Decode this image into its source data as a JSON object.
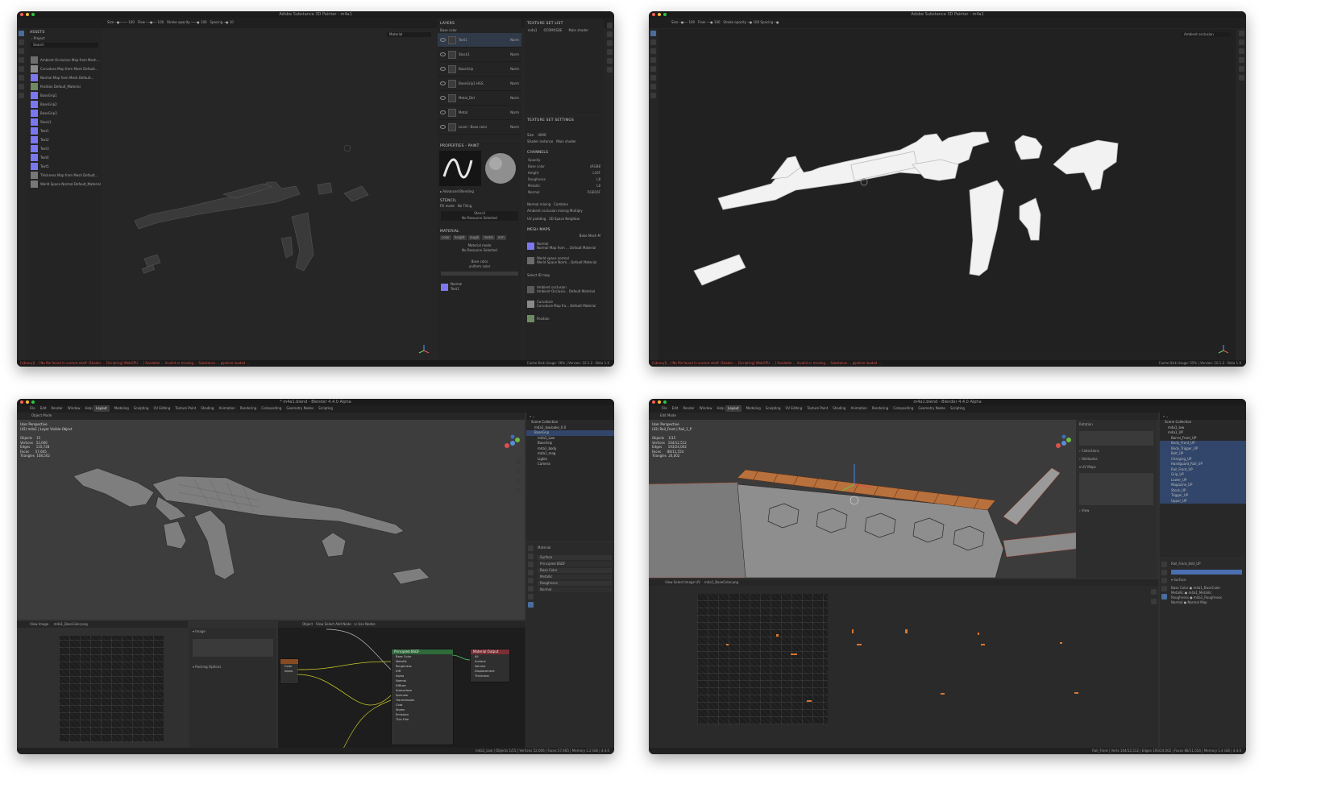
{
  "panels": [
    {
      "id": "sp1",
      "app": "Adobe Substance 3D Painter",
      "title": "Adobe Substance 3D Painter - m4a1",
      "assets": {
        "header": "ASSETS",
        "tab": "Project",
        "search": "Search",
        "items": [
          "Ambient Occlusion Map from Mesh ...",
          "Curvature Map from Mesh Default...",
          "Normal Map from Mesh Default...",
          "Position Default_Material",
          "BaseGrip1",
          "BaseGrip2",
          "BaseGrip3",
          "Stock1",
          "Text1",
          "Text2",
          "Text3",
          "Text4",
          "Text5",
          "Thickness Map from Mesh Default...",
          "World Space Normal Default_Material"
        ]
      },
      "layers": {
        "header": "LAYERS",
        "blend": "Base color",
        "items": [
          "Text1",
          "Stock1",
          "BaseGrip",
          "BaseGrip1 HGS",
          "Metal_Dirt",
          "Metal",
          "Level - Base color"
        ],
        "blend_mode": "Norm",
        "opacity": "100"
      },
      "properties": {
        "header": "PROPERTIES - PAINT",
        "advanced": "Advanced Blending",
        "stencil": "STENCIL",
        "projection_label": "Fill mode",
        "projection_value": "No Tiling",
        "stencil_empty": "Stencil",
        "no_resource": "No Resource Selected",
        "material": "MATERIAL",
        "channels": [
          "color",
          "height",
          "rough",
          "metal",
          "nrm"
        ],
        "material_mode": "Material mode",
        "base_color": "Base color",
        "uniform": "uniform color",
        "normal": "Normal",
        "normal_value": "Text1"
      },
      "texture_set_list": {
        "header": "TEXTURE SET LIST",
        "columns": [
          "m4a1",
          "OCRMXSDE",
          "Main shader"
        ]
      },
      "texture_set_settings": {
        "header": "TEXTURE SET SETTINGS",
        "size_label": "Size",
        "size_value": "4096",
        "shader_label": "Shader instance",
        "shader_value": "Main shader",
        "channels_header": "CHANNELS",
        "channels": [
          {
            "name": "Opacity",
            "value": ""
          },
          {
            "name": "Base color",
            "value": "sRGB8"
          },
          {
            "name": "Height",
            "value": "L16F"
          },
          {
            "name": "Roughness",
            "value": "L8"
          },
          {
            "name": "Metallic",
            "value": "L8"
          },
          {
            "name": "Normal",
            "value": "RGB16F"
          }
        ],
        "normal_mixing_label": "Normal mixing",
        "normal_mixing_value": "Combine",
        "ao_mixing_label": "Ambient occlusion mixing",
        "ao_mixing_value": "Multiply",
        "uv_label": "UV padding",
        "uv_value": "3D Space Neighbor",
        "mesh_maps": "MESH MAPS",
        "bake": "Bake Mesh M",
        "maps": [
          {
            "name": "Normal",
            "desc": "Normal Map from ... Default Material",
            "color": "#7d78f0"
          },
          {
            "name": "World space normal",
            "desc": "World Space Norm... Default Material",
            "color": "#6b6b6b"
          },
          {
            "name": "Select ID map",
            "desc": "",
            "color": ""
          },
          {
            "name": "Ambient occlusion",
            "desc": "Ambient Occlusio... Default Material",
            "color": "#5a5a5a"
          },
          {
            "name": "Curvature",
            "desc": "Curvature Map fro... Default Material",
            "color": "#8a8a8a"
          },
          {
            "name": "Position",
            "desc": "",
            "color": "#6e8a62"
          }
        ]
      },
      "viewport_mode": "Material",
      "status_error": "[Library][...] No file found in current shelf: /Shader ... [Scripting] WebGPU ... ] Available ... Invalid or missing ... Substance ... pipeline loaded ...",
      "status_info": "Cache Disk Usage: 56% | Version: 10.1.2 - Beta 1.0"
    },
    {
      "id": "sp2",
      "app": "Adobe Substance 3D Painter",
      "title": "Adobe Substance 3D Painter - m4a1",
      "viewport_mode": "Ambient occlusion",
      "status_error": "[Library][...] No file found in current shelf: /Shader ... [Scripting] WebGPU ... ] Available ... Invalid or missing ... Substance ... pipeline loaded ...",
      "status_info": "Cache Disk Usage: 55% | Version: 10.1.2 - Beta 1.0"
    },
    {
      "id": "bl1",
      "app": "Blender",
      "title": "* m4a1.blend - Blender 4.4.0 Alpha",
      "menu": [
        "File",
        "Edit",
        "Render",
        "Window",
        "Help"
      ],
      "workspaces": [
        "Layout",
        "Modeling",
        "Sculpting",
        "UV Editing",
        "Texture Paint",
        "Shading",
        "Animation",
        "Rendering",
        "Compositing",
        "Geometry Nodes",
        "Scripting"
      ],
      "active_workspace": "Layout",
      "mode": "Object Mode",
      "viewport_header": "User Perspective",
      "viewport_sub": "(42) m4a1 | Layer Visible Object",
      "stats": "Objects    15\nVertices   52,006\nEdges      110,728\nFaces      57,665\nTriangles  108,502",
      "outliner": [
        "Scene Collection",
        "m4a1_low.bake_0.0",
        "BaseGrip",
        "m4a1_Low",
        "BaseGrip",
        "m4a1_body",
        "m4a1_mag",
        "Lights",
        "Camera"
      ],
      "image_name": "m4a1_BaseColor.png",
      "node_name": "Principled BSDF",
      "node_rows": [
        "Base Color",
        "Metallic",
        "Roughness",
        "IOR",
        "Alpha",
        "Normal",
        "Diffuse",
        "Subsurface",
        "Specular",
        "Transmission",
        "Coat",
        "Sheen",
        "Emission",
        "Thin Film"
      ],
      "output_node": "Material Output",
      "output_rows": [
        "All",
        "Surface",
        "Volume",
        "Displacement",
        "Thickness"
      ],
      "texture_node_rows": [
        "Color",
        "Alpha"
      ],
      "props_header": "Material",
      "props_rows": [
        "Surface",
        "Principled BSDF",
        "Base Color",
        "Metallic",
        "Roughness",
        "Normal"
      ],
      "status": "m4a1_Low | Objects 1/15 | Vertices 52,006 | Faces 57,665 | Memory 1.2 GiB | 4.4.0"
    },
    {
      "id": "bl2",
      "app": "Blender",
      "title": "m4a1.blend - Blender 4.4.0 Alpha",
      "menu": [
        "File",
        "Edit",
        "Render",
        "Window",
        "Help"
      ],
      "workspaces": [
        "Layout",
        "Modeling",
        "Sculpting",
        "UV Editing",
        "Texture Paint",
        "Shading",
        "Animation",
        "Rendering",
        "Compositing",
        "Geometry Nodes",
        "Scripting"
      ],
      "active_workspace": "Layout",
      "mode": "Edit Mode",
      "viewport_header": "User Perspective",
      "viewport_sub": "(42) Rail_Front | Rail_1_P",
      "stats": "Objects    1/15\nVertices   104/12,512\nEdges      193/24,002\nFaces      88/11,554\nTriangles  24,002",
      "outliner": [
        "Scene Collection",
        "m4a1_low",
        "m4a1_UP",
        "Barrel_Front_UP",
        "Body_Front_UP",
        "Body_Trigger_UP",
        "Bolt_UP",
        "Charging_UP",
        "Handguard_Rail_UP",
        "Rail_Front_UP",
        "Grip_UP",
        "Lower_UP",
        "Magazine_UP",
        "Stock_UP",
        "Trigger_UP",
        "Upper_UP"
      ],
      "image_name": "m4a1_BaseColor.png",
      "props_header": "Rail_Front_Edit_UP",
      "status": "Rail_Front | Verts 104/12,512 | Edges 193/24,002 | Faces 88/11,554 | Memory 1.4 GiB | 4.4.0"
    }
  ]
}
